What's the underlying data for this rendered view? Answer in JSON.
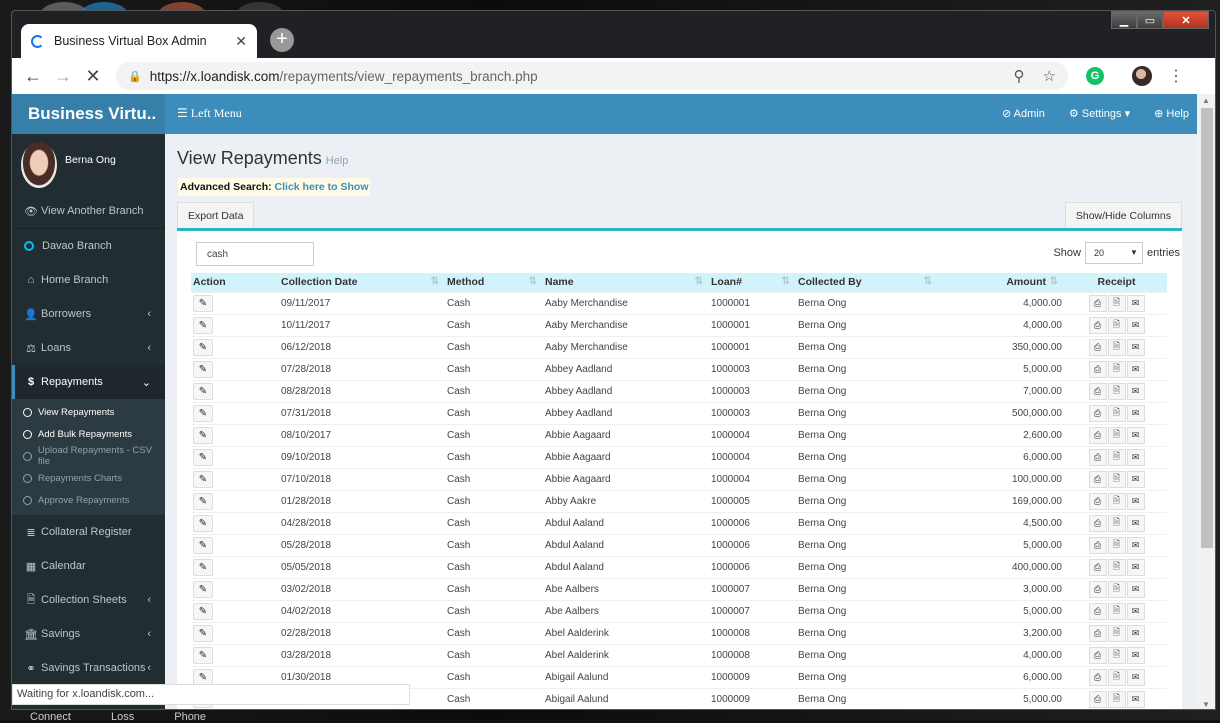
{
  "browser": {
    "tab_title": "Business Virtual Box Admin",
    "url_host": "https://x.loandisk.com",
    "url_path": "/repayments/view_repayments_branch.php",
    "status_text": "Waiting for x.loandisk.com...",
    "extension_label": "G"
  },
  "taskbar": [
    "Connect",
    "Loss",
    "Phone"
  ],
  "app": {
    "logo": "Business Virtu..",
    "user_name": "Berna Ong",
    "left_menu_label": "Left Menu",
    "topnav": [
      {
        "icon": "⊘",
        "label": "Admin"
      },
      {
        "icon": "⚙",
        "label": "Settings ▾"
      },
      {
        "icon": "⊕",
        "label": "Help"
      }
    ]
  },
  "sidebar": {
    "items": [
      {
        "icon": "👁",
        "label": "View Another Branch"
      },
      {
        "label": "Davao Branch"
      },
      {
        "icon": "⌂",
        "label": "Home Branch"
      },
      {
        "icon": "👤",
        "label": "Borrowers"
      },
      {
        "icon": "⚖",
        "label": "Loans"
      },
      {
        "icon": "$",
        "label": "Repayments"
      },
      {
        "icon": "≣",
        "label": "Collateral Register"
      },
      {
        "icon": "▦",
        "label": "Calendar"
      },
      {
        "icon": "🗎",
        "label": "Collection Sheets"
      },
      {
        "icon": "🏛",
        "label": "Savings"
      },
      {
        "icon": "⚭",
        "label": "Savings Transactions"
      }
    ],
    "sub_items": [
      "View Repayments",
      "Add Bulk Repayments",
      "Upload Repayments - CSV file",
      "Repayments Charts",
      "Approve Repayments"
    ]
  },
  "main": {
    "title": "View Repayments",
    "help": "Help",
    "advanced_label": "Advanced Search:",
    "advanced_link": "Click here to Show",
    "export_btn": "Export Data",
    "columns_btn": "Show/Hide Columns",
    "search_value": "cash",
    "show_label": "Show",
    "entries_value": "20",
    "entries_label": "entries",
    "headers": [
      "Action",
      "Collection Date",
      "Method",
      "Name",
      "Loan#",
      "Collected By",
      "Amount",
      "Receipt"
    ],
    "rows": [
      [
        "09/11/2017",
        "Cash",
        "Aaby Merchandise",
        "1000001",
        "Berna Ong",
        "4,000.00"
      ],
      [
        "10/11/2017",
        "Cash",
        "Aaby Merchandise",
        "1000001",
        "Berna Ong",
        "4,000.00"
      ],
      [
        "06/12/2018",
        "Cash",
        "Aaby Merchandise",
        "1000001",
        "Berna Ong",
        "350,000.00"
      ],
      [
        "07/28/2018",
        "Cash",
        "Abbey Aadland",
        "1000003",
        "Berna Ong",
        "5,000.00"
      ],
      [
        "08/28/2018",
        "Cash",
        "Abbey Aadland",
        "1000003",
        "Berna Ong",
        "7,000.00"
      ],
      [
        "07/31/2018",
        "Cash",
        "Abbey Aadland",
        "1000003",
        "Berna Ong",
        "500,000.00"
      ],
      [
        "08/10/2017",
        "Cash",
        "Abbie Aagaard",
        "1000004",
        "Berna Ong",
        "2,600.00"
      ],
      [
        "09/10/2018",
        "Cash",
        "Abbie Aagaard",
        "1000004",
        "Berna Ong",
        "6,000.00"
      ],
      [
        "07/10/2018",
        "Cash",
        "Abbie Aagaard",
        "1000004",
        "Berna Ong",
        "100,000.00"
      ],
      [
        "01/28/2018",
        "Cash",
        "Abby Aakre",
        "1000005",
        "Berna Ong",
        "169,000.00"
      ],
      [
        "04/28/2018",
        "Cash",
        "Abdul Aaland",
        "1000006",
        "Berna Ong",
        "4,500.00"
      ],
      [
        "05/28/2018",
        "Cash",
        "Abdul Aaland",
        "1000006",
        "Berna Ong",
        "5,000.00"
      ],
      [
        "05/05/2018",
        "Cash",
        "Abdul Aaland",
        "1000006",
        "Berna Ong",
        "400,000.00"
      ],
      [
        "03/02/2018",
        "Cash",
        "Abe Aalbers",
        "1000007",
        "Berna Ong",
        "3,000.00"
      ],
      [
        "04/02/2018",
        "Cash",
        "Abe Aalbers",
        "1000007",
        "Berna Ong",
        "5,000.00"
      ],
      [
        "02/28/2018",
        "Cash",
        "Abel Aalderink",
        "1000008",
        "Berna Ong",
        "3,200.00"
      ],
      [
        "03/28/2018",
        "Cash",
        "Abel Aalderink",
        "1000008",
        "Berna Ong",
        "4,000.00"
      ],
      [
        "01/30/2018",
        "Cash",
        "Abigail Aalund",
        "1000009",
        "Berna Ong",
        "6,000.00"
      ],
      [
        "",
        "Cash",
        "Abigail Aalund",
        "1000009",
        "Berna Ong",
        "5,000.00"
      ]
    ]
  }
}
